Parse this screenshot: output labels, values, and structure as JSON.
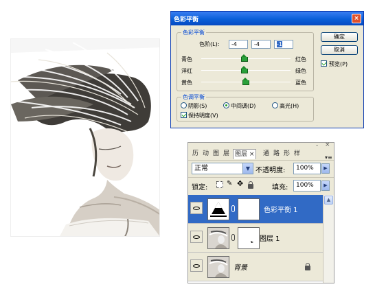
{
  "dialog": {
    "title": "色彩平衡",
    "close": "×",
    "color_balance_group": "色彩平衡",
    "levels_label": "色阶(L):",
    "levels": [
      "-4",
      "-4",
      "-1"
    ],
    "sliders": [
      {
        "left": "青色",
        "right": "红色",
        "value": -4
      },
      {
        "left": "洋红",
        "right": "绿色",
        "value": -4
      },
      {
        "left": "黄色",
        "right": "蓝色",
        "value": -1
      }
    ],
    "tone_group": "色调平衡",
    "tones": [
      {
        "label": "阴影(S)",
        "selected": false
      },
      {
        "label": "中间调(D)",
        "selected": true
      },
      {
        "label": "高光(H)",
        "selected": false
      }
    ],
    "preserve_label": "保持明度(V)",
    "preserve_checked": true,
    "ok_label": "确定",
    "cancel_label": "取消",
    "preview_label": "预览(P)",
    "preview_checked": true
  },
  "layers_panel": {
    "tabs": [
      "历",
      "动",
      "图",
      "层",
      "图层 ×",
      "通",
      "路",
      "形",
      "样"
    ],
    "active_tab": "图层",
    "close": "×",
    "minimize": "-",
    "menu": "▾≡",
    "blend_mode": "正常",
    "opacity_label": "不透明度:",
    "opacity_value": "100%",
    "lock_label": "锁定:",
    "fill_label": "填充:",
    "fill_value": "100%",
    "layers": [
      {
        "name": "色彩平衡 1",
        "selected": true,
        "type": "adjustment"
      },
      {
        "name": "图层 1",
        "selected": false,
        "type": "masked"
      },
      {
        "name": "背景",
        "selected": false,
        "type": "background",
        "locked": true
      }
    ]
  },
  "colors": {
    "titlebar": "#0a5fd8",
    "selected_layer": "#316ac5",
    "group_title": "#0046d5",
    "slider_thumb": "#2aa03a"
  }
}
